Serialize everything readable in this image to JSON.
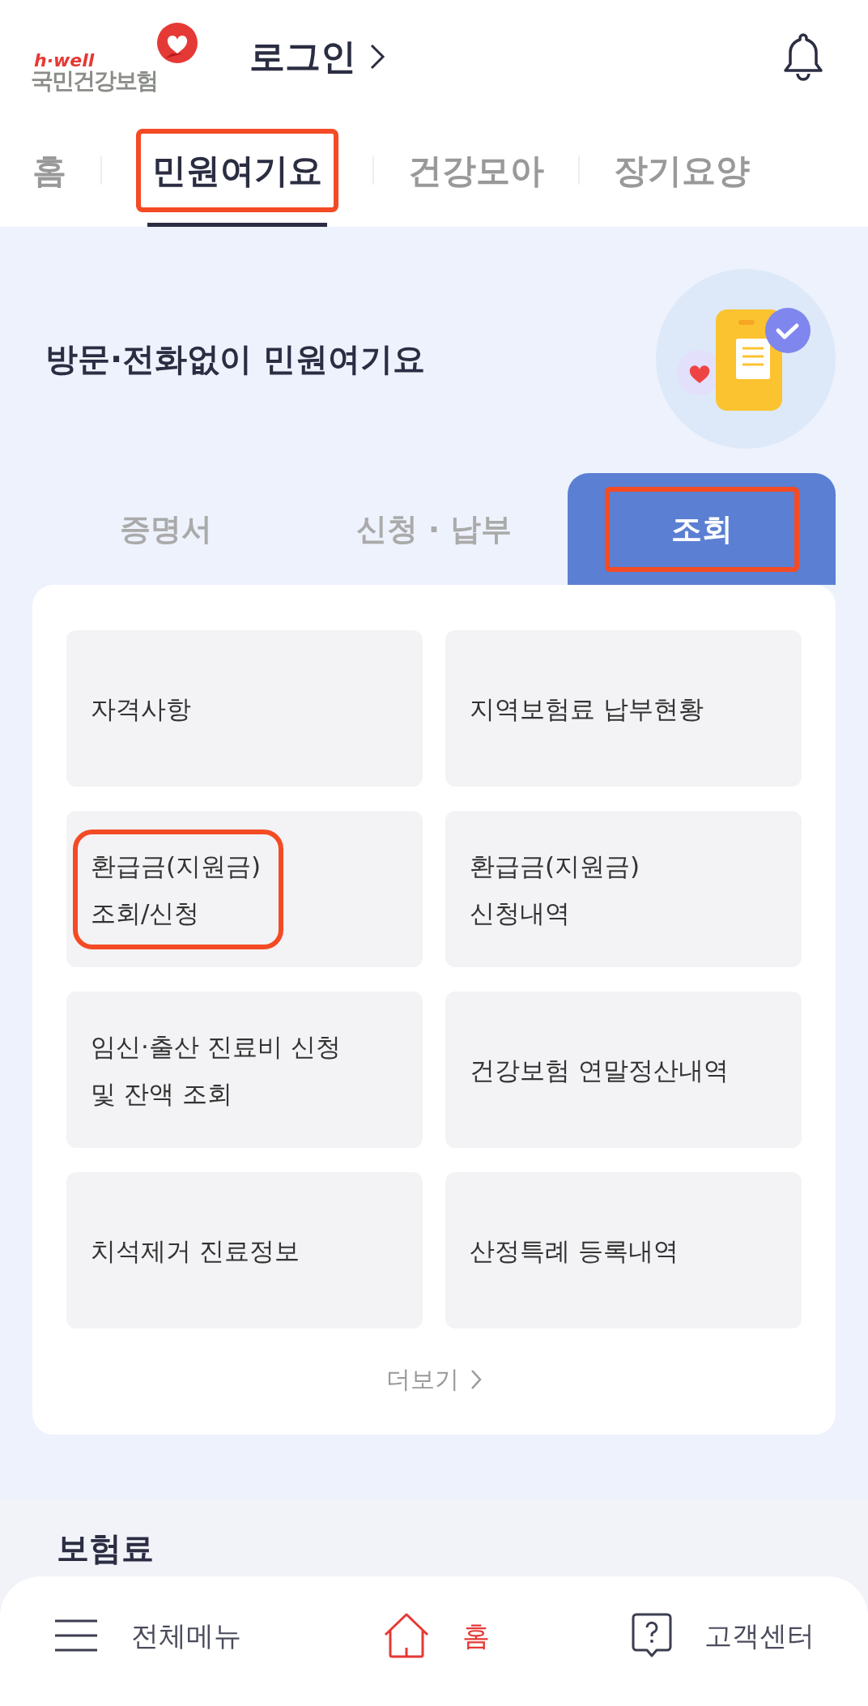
{
  "header": {
    "logo_tagline": "h·well",
    "logo_name": "국민건강보험",
    "login": "로그인"
  },
  "tabs": [
    {
      "label": "홈",
      "selected": false,
      "highlighted": false
    },
    {
      "label": "민원여기요",
      "selected": true,
      "highlighted": true
    },
    {
      "label": "건강모아",
      "selected": false,
      "highlighted": false
    },
    {
      "label": "장기요양",
      "selected": false,
      "highlighted": false
    }
  ],
  "hero": {
    "title": "방문·전화없이 민원여기요"
  },
  "sub_tabs": [
    {
      "label": "증명서",
      "selected": false,
      "highlighted": false
    },
    {
      "label": "신청 · 납부",
      "selected": false,
      "highlighted": false
    },
    {
      "label": "조회",
      "selected": true,
      "highlighted": true
    }
  ],
  "menu_items": [
    {
      "label": "자격사항",
      "highlighted": false
    },
    {
      "label": "지역보험료 납부현황",
      "highlighted": false
    },
    {
      "label": "환급금(지원금)\n조회/신청",
      "highlighted": true
    },
    {
      "label": "환급금(지원금)\n신청내역",
      "highlighted": false
    },
    {
      "label": "임신·출산 진료비 신청\n및 잔액 조회",
      "highlighted": false
    },
    {
      "label": "건강보험 연말정산내역",
      "highlighted": false
    },
    {
      "label": "치석제거 진료정보",
      "highlighted": false
    },
    {
      "label": "산정특례 등록내역",
      "highlighted": false
    }
  ],
  "more": "더보기",
  "next_section": "보험료",
  "bottom_nav": [
    {
      "kind": "menu",
      "label": "전체메뉴",
      "selected": false
    },
    {
      "kind": "home",
      "label": "홈",
      "selected": true
    },
    {
      "kind": "help",
      "label": "고객센터",
      "selected": false
    }
  ]
}
